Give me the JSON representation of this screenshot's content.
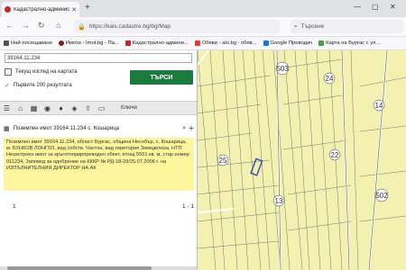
{
  "browser": {
    "tab_title": "Кадастрално-административ...",
    "close_icon": "close-icon",
    "new_tab": "+",
    "window_controls": [
      "—",
      "▢",
      "✕"
    ],
    "url": "https://kais.cadastre.bg/bg/Map",
    "search_placeholder": "Търсене",
    "bookmarks": [
      {
        "label": "Най-посещавани",
        "icon": "gear-icon",
        "color": "#555555"
      },
      {
        "label": "Имоти - Imot.bg - Па...",
        "icon": "imot-icon",
        "color": "#8b1a1a"
      },
      {
        "label": "Кадастрално-админи...",
        "icon": "cadastre-icon",
        "color": "#c62828"
      },
      {
        "label": "Обяви - alo.bg - обяв...",
        "icon": "alo-icon",
        "color": "#e53935"
      },
      {
        "label": "Google Преводач",
        "icon": "translate-icon",
        "color": "#1a73e8"
      },
      {
        "label": "Карта на Бургас с ул...",
        "icon": "map-icon",
        "color": "#43a047"
      }
    ]
  },
  "panel": {
    "search_value": "39164.11.234",
    "option_current_view": "Текущ изглед на картата",
    "option_first_200": "Първите 200 резултата",
    "search_button": "ТЪРСИ",
    "tools": [
      "list-icon",
      "home-icon",
      "grid-icon",
      "location-icon",
      "pin-icon",
      "layers-icon",
      "upload-icon",
      "measure-icon"
    ],
    "tools_label": "Ключи",
    "object_title": "Поземлен имот 39164.11.234 с. Кошарица",
    "info_text": "Поземлен имот 39164.11.234, област Бургас, община Несебър, с. Кошарица, м. БУНКОВ ЛОНГОЗ, вид собств. Частна, вид територия Земеделска, НТП Незастроен имот за кръготоприрпреводен обект, площ 5551 кв. м, стар номер 011234, Заповед за одобрение на КККР № РД-18-29/25.07.2006 г. на ИЗПЪЛНИТЕЛНИЯ ДИРЕКТОР НА АК",
    "page_number": "1",
    "page_range": "1 - 1"
  },
  "map": {
    "labels": [
      "503",
      "24",
      "14",
      "22",
      "25",
      "13",
      "502"
    ],
    "colors": {
      "field": "#f3f1b0",
      "lines": "#6d6d6d",
      "roads": "#ffffff",
      "selected": "#3f51b5"
    }
  }
}
